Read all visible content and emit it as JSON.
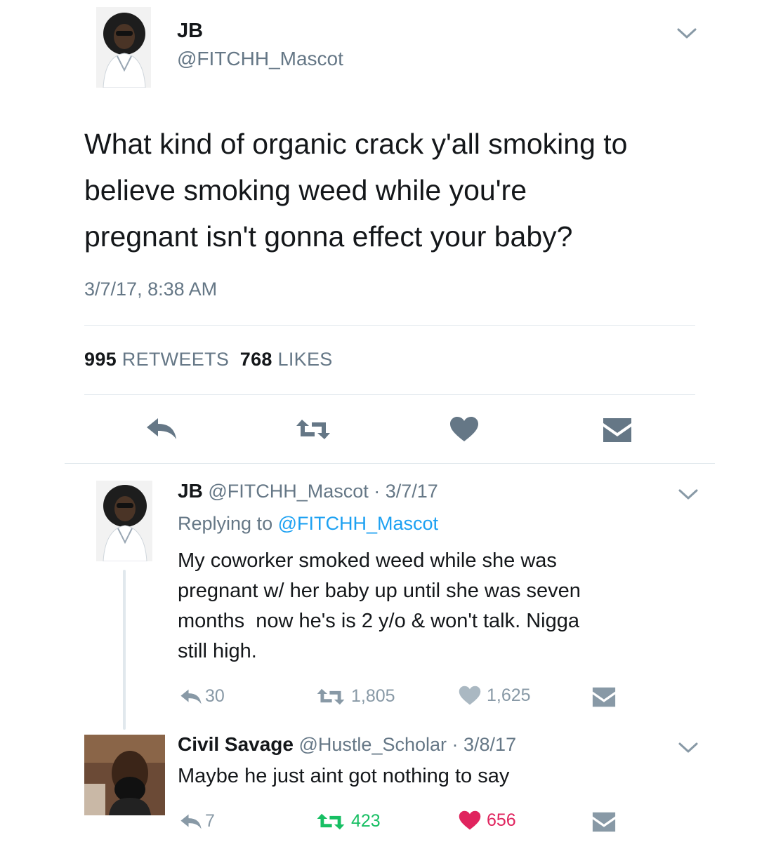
{
  "main_tweet": {
    "author_name": "JB",
    "author_handle": "@FITCHH_Mascot",
    "text_lines": [
      "What kind of organic crack y'all smoking to",
      "believe smoking weed while you're",
      "pregnant isn't gonna effect your baby?"
    ],
    "timestamp": "3/7/17, 8:38 AM",
    "retweets_count": "995",
    "retweets_label": "RETWEETS",
    "likes_count": "768",
    "likes_label": "LIKES",
    "actions": [
      "reply-icon",
      "retweet-icon",
      "heart-icon",
      "mail-icon"
    ]
  },
  "replies": [
    {
      "name": "JB",
      "handle": "@FITCHH_Mascot",
      "date": "· 3/7/17",
      "replying_prefix": "Replying to",
      "replying_to": "@FITCHH_Mascot",
      "text_lines": [
        "My coworker smoked weed while she was",
        "pregnant w/ her baby up until she was seven",
        "months  now he's is 2 y/o & won't talk. Nigga",
        "still high."
      ],
      "reply_count": "30",
      "retweet_count": "1,805",
      "like_count": "1,625"
    },
    {
      "name": "Civil Savage",
      "handle": "@Hustle_Scholar",
      "date": "· 3/8/17",
      "text_lines": [
        "Maybe he just aint got nothing to say"
      ],
      "reply_count": "7",
      "retweet_count": "423",
      "like_count": "656",
      "retweeted_color": "#17bf63",
      "liked_color": "#e0245e"
    }
  ],
  "colors": {
    "text": "#14171a",
    "secondary": "#657786",
    "icon_gray": "#8899a6",
    "link_blue": "#1da1f2",
    "divider": "#e1e8ed"
  }
}
